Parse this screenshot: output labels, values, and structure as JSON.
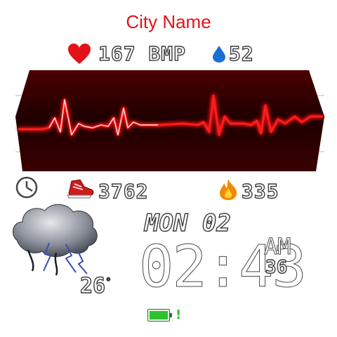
{
  "location": {
    "city": "City Name"
  },
  "health": {
    "heart_rate": "167 BMP",
    "humidity": "52",
    "steps": "3762",
    "calories": "335"
  },
  "datetime": {
    "date": "MON 02",
    "time": "02:43",
    "ampm": "AM",
    "seconds": "36"
  },
  "weather": {
    "temperature": "26",
    "degree_symbol": "°",
    "condition_icon": "storm-cloud-icon"
  },
  "battery": {
    "level": 1.0,
    "indicator": "!"
  },
  "colors": {
    "accent": "#e3121a",
    "drop": "#1a6fd6",
    "flame": "#f08a00",
    "battery": "#2fc22f",
    "banner_bg": "#2a0000",
    "ecg_line": "#ff1a1a"
  },
  "icons": [
    "heart-icon",
    "drop-icon",
    "clock-icon",
    "shoe-icon",
    "flame-icon",
    "storm-cloud-icon",
    "battery-icon"
  ]
}
